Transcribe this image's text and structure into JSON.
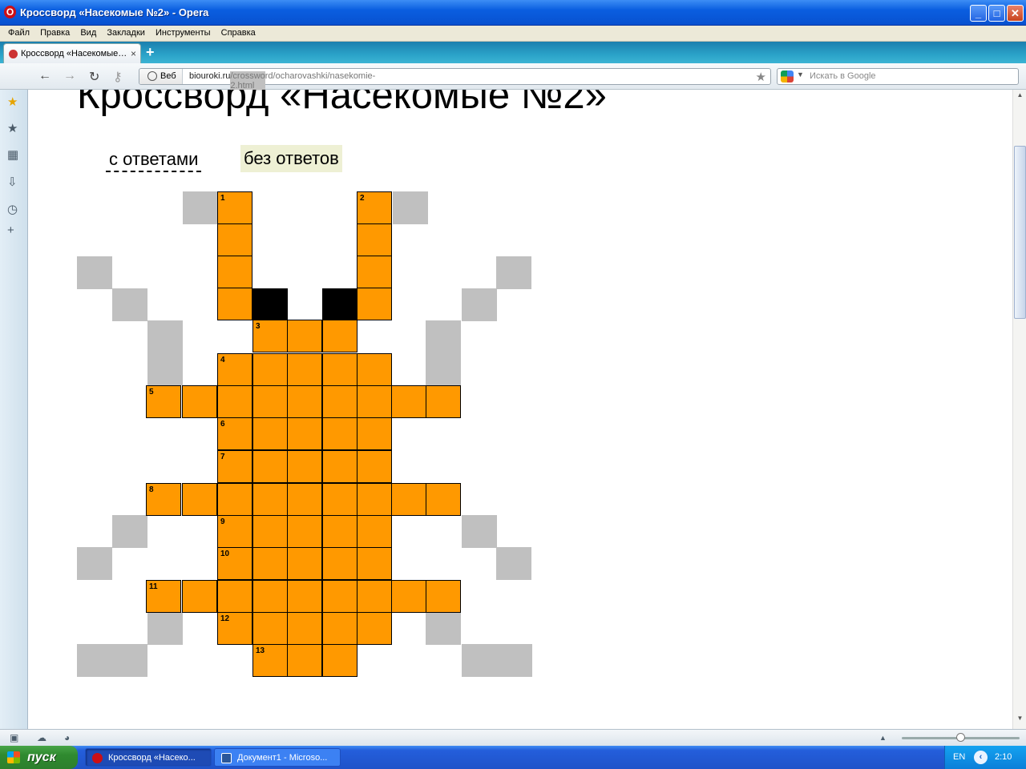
{
  "window": {
    "title": "Кроссворд «Насекомые №2» - Opera",
    "logo": "O",
    "minimize": "_",
    "maximize": "□",
    "close": "✕"
  },
  "menu": [
    "Файл",
    "Правка",
    "Вид",
    "Закладки",
    "Инструменты",
    "Справка"
  ],
  "tab": {
    "label": "Кроссворд «Насекомые…",
    "close": "×",
    "new": "+"
  },
  "address": {
    "web_label": "Веб",
    "host": "biouroki.ru",
    "path": "/crossword/ocharovashki/nasekomie-2.html"
  },
  "search": {
    "placeholder": "Искать в Google"
  },
  "page": {
    "title": "Кроссворд «Насекомые №2»",
    "with_answers": "с ответами",
    "without_answers": "без ответов"
  },
  "crossword": {
    "numbers": [
      "1",
      "2",
      "3",
      "4",
      "5",
      "6",
      "7",
      "8",
      "9",
      "10",
      "11",
      "12",
      "13"
    ]
  },
  "taskbar": {
    "start": "пуск",
    "tasks": [
      "Кроссворд «Насеко...",
      "Документ1 - Microso..."
    ],
    "lang": "EN",
    "time": "2:10"
  },
  "icons": {
    "back": "back-arrow-icon",
    "forward": "forward-arrow-icon",
    "reload": "reload-icon",
    "key": "key-icon",
    "bookmark": "star-icon"
  }
}
